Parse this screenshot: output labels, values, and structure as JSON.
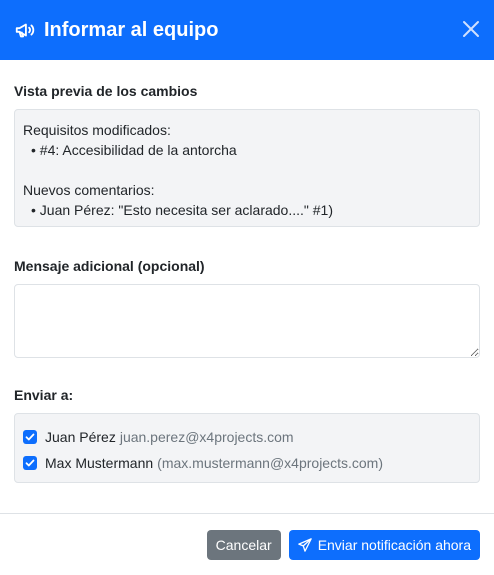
{
  "modal": {
    "title": "Informar al equipo",
    "icons": {
      "title_icon": "megaphone-icon",
      "close_icon": "close-icon"
    }
  },
  "preview": {
    "label": "Vista previa de los cambios",
    "modified_heading": "Requisitos modificados:",
    "modified_items": [
      "• #4: Accesibilidad de la antorcha"
    ],
    "comments_heading": "Nuevos comentarios:",
    "comment_items": [
      "• Juan Pérez: \"Esto necesita ser aclarado....\" #1)"
    ]
  },
  "message": {
    "label": "Mensaje adicional (opcional)",
    "value": "",
    "placeholder": ""
  },
  "recipients": {
    "label": "Enviar a:",
    "items": [
      {
        "name": "Juan Pérez",
        "email": "juan.perez@x4projects.com",
        "checked": true
      },
      {
        "name": "Max Mustermann",
        "email": "(max.mustermann@x4projects.com)",
        "checked": true
      }
    ]
  },
  "footer": {
    "cancel_label": "Cancelar",
    "send_label": "Enviar notificación ahora",
    "send_icon": "send-icon"
  },
  "colors": {
    "primary": "#0d6efd",
    "secondary": "#6c757d",
    "panel_bg": "#f3f4f6",
    "border": "#dee2e6"
  }
}
